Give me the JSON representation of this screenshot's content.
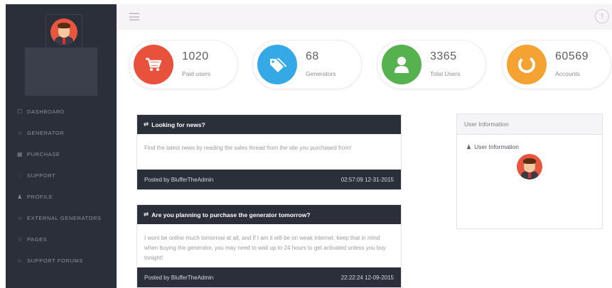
{
  "sidebar": {
    "nav": [
      {
        "label": "DASHBOARD",
        "icon": "☐"
      },
      {
        "label": "GENERATOR",
        "icon": "☆"
      },
      {
        "label": "PURCHASE",
        "icon": "▦"
      },
      {
        "label": "SUPPORT",
        "icon": "◌"
      },
      {
        "label": "PROFILE",
        "icon": "♟"
      },
      {
        "label": "EXTERNAL GENERATORS",
        "icon": "☆"
      },
      {
        "label": "PAGES",
        "icon": "☆"
      },
      {
        "label": "SUPPORT FORUMS",
        "icon": "☆"
      }
    ]
  },
  "topbar": {
    "info_glyph": "!"
  },
  "stats": [
    {
      "value": "1020",
      "label": "Paid users",
      "color": "#e8523c",
      "icon": "cart-icon"
    },
    {
      "value": "68",
      "label": "Generators",
      "color": "#35a8e6",
      "icon": "tags-icon"
    },
    {
      "value": "3365",
      "label": "Total Users",
      "color": "#56b14f",
      "icon": "user-icon"
    },
    {
      "value": "60569",
      "label": "Accounts",
      "color": "#f4a231",
      "icon": "ring-icon"
    }
  ],
  "news": [
    {
      "icon": "⇄",
      "title": "Looking for news?",
      "body": "Find the latest news by reading the sales thread from the site you purchased from!",
      "author": "Posted by BlufferTheAdmin",
      "timestamp": "02:57:09 12-31-2015"
    },
    {
      "icon": "⇄",
      "title": "Are you planning to purchase the generator tomorrow?",
      "body": "I wont be online much tomorrow at all, and if I am it will be on weak internet, keep that in mind when buying the generator, you may need to wait up to 24 hours to get activated unless you buy tonight!",
      "author": "Posted by BlufferTheAdmin",
      "timestamp": "22:22:24 12-09-2015"
    }
  ],
  "user_panel": {
    "title": "User Information",
    "subtitle": "User Information",
    "icon": "♟"
  },
  "colors": {
    "sidebar_bg": "#2b2f3a",
    "card_header_bg": "#2b2f3a",
    "avatar_bg": "#e8563f"
  }
}
